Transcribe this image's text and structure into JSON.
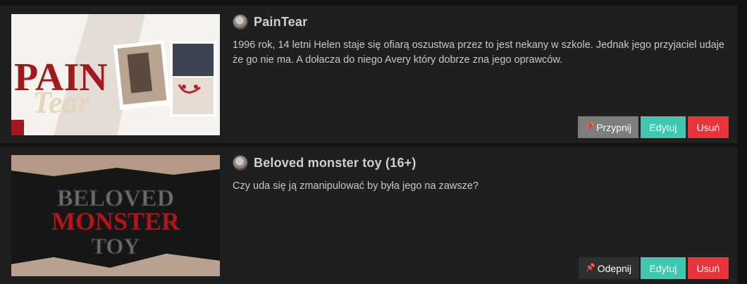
{
  "stories": [
    {
      "title": "PainTear",
      "description": "1996 rok, 14 letni Helen staje się ofiarą oszustwa przez to jest nekany w szkole. Jednak jego przyjaciel udaje że go nie ma. A dołacza do niego Avery który dobrze zna jego oprawców.",
      "cover_text": [
        "PAIN",
        "Tear"
      ],
      "pin_label": "Przypnij",
      "edit_label": "Edytuj",
      "delete_label": "Usuń"
    },
    {
      "title": "Beloved monster toy (16+)",
      "description": "Czy uda się ją zmanipulować by była jego na zawsze?",
      "cover_text": [
        "BELOVED",
        "MONSTER",
        "TOY"
      ],
      "pin_label": "Odepnij",
      "edit_label": "Edytuj",
      "delete_label": "Usuń"
    }
  ],
  "icons": {
    "pin": "pushpin-icon",
    "avatar": "avatar"
  },
  "colors": {
    "edit": "#3fc8ad",
    "delete": "#e8333b",
    "pin": "#7d7d7d",
    "unpin": "#2f2f2f"
  }
}
